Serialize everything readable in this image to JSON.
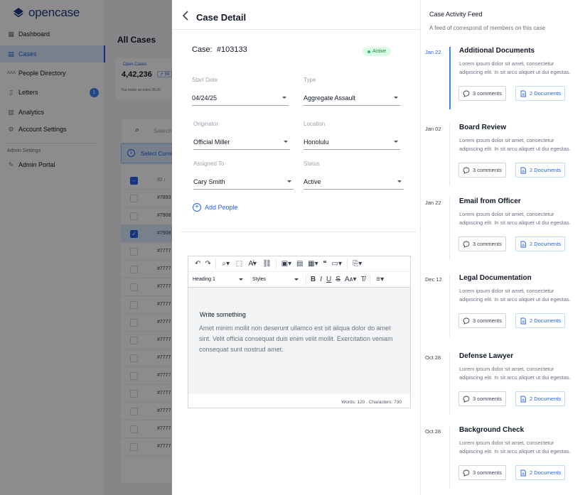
{
  "app": {
    "logo_text": "opencase"
  },
  "sidebar": {
    "items": [
      {
        "label": "Dashboard"
      },
      {
        "label": "Cases"
      },
      {
        "label": "People Directory"
      },
      {
        "label": "Letters",
        "badge": "1"
      },
      {
        "label": "Analytics"
      },
      {
        "label": "Account Settings"
      }
    ],
    "admin_section": "Admin Settings",
    "admin_items": [
      {
        "label": "Admin Portal"
      }
    ]
  },
  "background": {
    "page_title": "All Cases",
    "stat_label": "Open Cases",
    "stat_value": "4,42,236",
    "stat_chip": "59",
    "stat_note": "You made an extra 35,00",
    "search_placeholder": "Search",
    "select_banner": "Select Curre",
    "id_header": "ID",
    "rows": [
      "#7893",
      "#7908",
      "#7908",
      "#7777",
      "#7777",
      "#7777",
      "#7777",
      "#7777",
      "#7777",
      "#7777",
      "#7777",
      "#7777",
      "#7777",
      "#7777",
      "#7777"
    ]
  },
  "detail": {
    "title": "Case Detail",
    "case_label": "Case:",
    "case_number": "#103133",
    "status_badge": "Active",
    "fields": {
      "start_date": {
        "label": "Start Date",
        "value": "04/24/25"
      },
      "type": {
        "label": "Type",
        "value": "Aggregate Assault"
      },
      "originator": {
        "label": "Originator",
        "value": "Official Miller"
      },
      "location": {
        "label": "Location",
        "value": "Honolulu"
      },
      "assigned_to": {
        "label": "Assigned To",
        "value": "Cary Smith"
      },
      "status": {
        "label": "Status",
        "value": "Active"
      }
    },
    "add_people": "Add People"
  },
  "editor": {
    "heading_select": "Heading 1",
    "styles_select": "Styles",
    "heading": "Write something",
    "body": "Amet minim mollit non deserunt ullamco est sit aliqua dolor do amet sint. Velit officia consequat duis enim velit mollit. Exercitation veniam consequat sunt nostrud amet.",
    "footer": "Words: 120 . Characters: 730"
  },
  "feed": {
    "title": "Case Activity Feed",
    "subtitle": "A feed of correspond of members on this case",
    "items": [
      {
        "date": "Jan 22",
        "title": "Additional Documents",
        "body": "Lorem ipsum dolor sit amet, consectetur adipiscing elit. In sit arcu aliquet ut dui egestas.",
        "comments": "3 comments",
        "documents": "2 Documents"
      },
      {
        "date": "Jan 02",
        "title": "Board Review",
        "body": "Lorem ipsum dolor sit amet, consectetur adipiscing elit. In sit arcu aliquet ut dui egestas.",
        "comments": "3 comments",
        "documents": "2 Documents"
      },
      {
        "date": "Jan 22",
        "title": "Email from Officer",
        "body": "Lorem ipsum dolor sit amet, consectetur adipiscing elit. In sit arcu aliquet ut dui egestas.",
        "comments": "3 comments",
        "documents": "2 Documents"
      },
      {
        "date": "Dec 12",
        "title": "Legal Documentation",
        "body": "Lorem ipsum dolor sit amet, consectetur adipiscing elit. In sit arcu aliquet ut dui egestas.",
        "comments": "3 comments",
        "documents": "2 Documents"
      },
      {
        "date": "Oct 28",
        "title": "Defense Lawyer",
        "body": "Lorem ipsum dolor sit amet, consectetur adipiscing elit. In sit arcu aliquet ut dui egestas.",
        "comments": "3 comments",
        "documents": "2 Documents"
      },
      {
        "date": "Oct 28",
        "title": "Background Check",
        "body": "Lorem ipsum dolor sit amet, consectetur adipiscing elit. In sit arcu aliquet ut dui egestas.",
        "comments": "3 comments",
        "documents": "2 Documents"
      }
    ]
  },
  "colors": {
    "accent": "#2563eb",
    "active_green": "#15803d",
    "overlay": "#000000"
  }
}
